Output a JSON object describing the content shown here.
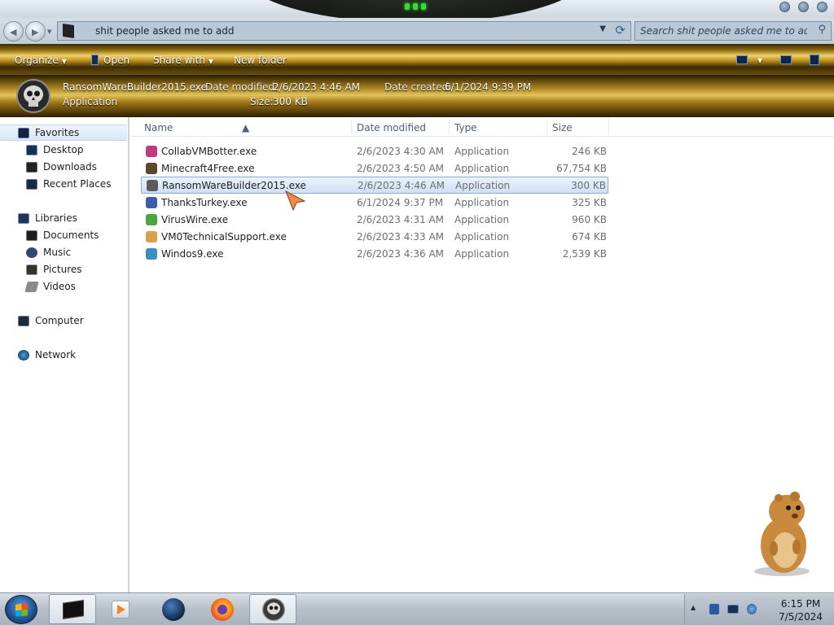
{
  "window": {
    "address_path": "shit people asked me to add",
    "search_placeholder": "Search shit people asked me to add"
  },
  "toolbar": {
    "organize": "Organize",
    "open": "Open",
    "share_with": "Share with",
    "new_folder": "New folder"
  },
  "details": {
    "filename": "RansomWareBuilder2015.exe",
    "date_modified_label": "Date modified:",
    "date_modified": "2/6/2023 4:46 AM",
    "date_created_label": "Date created:",
    "date_created": "6/1/2024 9:39 PM",
    "type": "Application",
    "size_label": "Size:",
    "size": "300 KB"
  },
  "nav": {
    "favorites": "Favorites",
    "desktop": "Desktop",
    "downloads": "Downloads",
    "recent_places": "Recent Places",
    "libraries": "Libraries",
    "documents": "Documents",
    "music": "Music",
    "pictures": "Pictures",
    "videos": "Videos",
    "computer": "Computer",
    "network": "Network"
  },
  "columns": {
    "name": "Name",
    "date_modified": "Date modified",
    "type": "Type",
    "size": "Size"
  },
  "files": [
    {
      "name": "CollabVMBotter.exe",
      "date": "2/6/2023 4:30 AM",
      "type": "Application",
      "size": "246 KB",
      "icon": "collabvm-icon",
      "color": "#c23a7a"
    },
    {
      "name": "Minecraft4Free.exe",
      "date": "2/6/2023 4:50 AM",
      "type": "Application",
      "size": "67,754 KB",
      "icon": "minecraft-icon",
      "color": "#5a4a2a"
    },
    {
      "name": "RansomWareBuilder2015.exe",
      "date": "2/6/2023 4:46 AM",
      "type": "Application",
      "size": "300 KB",
      "icon": "skull-icon",
      "color": "#5b5b5b"
    },
    {
      "name": "ThanksTurkey.exe",
      "date": "6/1/2024 9:37 PM",
      "type": "Application",
      "size": "325 KB",
      "icon": "turkey-icon",
      "color": "#3a5fa8"
    },
    {
      "name": "VirusWire.exe",
      "date": "2/6/2023 4:31 AM",
      "type": "Application",
      "size": "960 KB",
      "icon": "virus-icon",
      "color": "#4aa83a"
    },
    {
      "name": "VM0TechnicalSupport.exe",
      "date": "2/6/2023 4:33 AM",
      "type": "Application",
      "size": "674 KB",
      "icon": "support-person-icon",
      "color": "#d8a14a"
    },
    {
      "name": "Windos9.exe",
      "date": "2/6/2023 4:36 AM",
      "type": "Application",
      "size": "2,539 KB",
      "icon": "windows-icon",
      "color": "#3a8fc2"
    }
  ],
  "taskbar": {
    "time": "6:15 PM",
    "date": "7/5/2024"
  },
  "colors": {
    "accent_gold": "#d9b64a",
    "selection_border": "#84acdd"
  }
}
